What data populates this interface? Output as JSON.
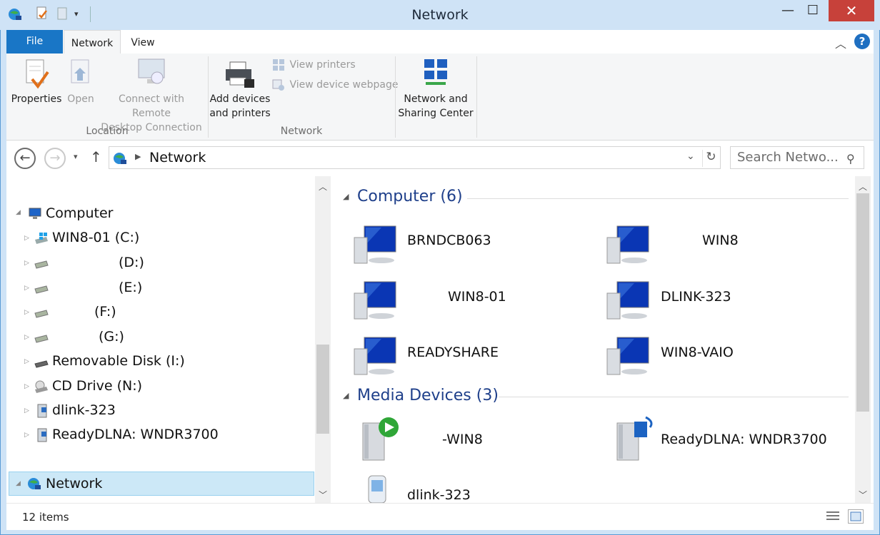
{
  "window": {
    "title": "Network",
    "minimize": "—",
    "maximize": "☐",
    "close": "✕"
  },
  "tabs": {
    "file": "File",
    "network": "Network",
    "view": "View"
  },
  "ribbon": {
    "properties": "Properties",
    "open": "Open",
    "remote_line1": "Connect with Remote",
    "remote_line2": "Desktop Connection",
    "group_location": "Location",
    "add_line1": "Add devices",
    "add_line2": "and printers",
    "view_printers": "View printers",
    "view_webpage": "View device webpage",
    "group_network": "Network",
    "nsc_line1": "Network and",
    "nsc_line2": "Sharing Center"
  },
  "address": {
    "path": "Network",
    "search_placeholder": "Search Netwo..."
  },
  "nav_tree": {
    "computer": "Computer",
    "drives": [
      "WIN8-01 (C:)",
      "(D:)",
      "(E:)",
      "(F:)",
      "(G:)",
      "Removable Disk (I:)",
      "CD Drive (N:)",
      "dlink-323",
      "ReadyDLNA: WNDR3700"
    ],
    "network": "Network"
  },
  "content": {
    "computer_header": "Computer (6)",
    "computers": [
      "BRNDCB063",
      "WIN8",
      "WIN8-01",
      "DLINK-323",
      "READYSHARE",
      "WIN8-VAIO"
    ],
    "media_header": "Media Devices (3)",
    "media": [
      "-WIN8",
      "ReadyDLNA: WNDR3700",
      "dlink-323"
    ]
  },
  "status": {
    "count": "12 items"
  },
  "colors": {
    "accent": "#1976c6",
    "title_bg": "#cfe3f6",
    "header_text": "#1e3f8a",
    "close_red": "#c7413a",
    "selection": "#cce8f7"
  }
}
